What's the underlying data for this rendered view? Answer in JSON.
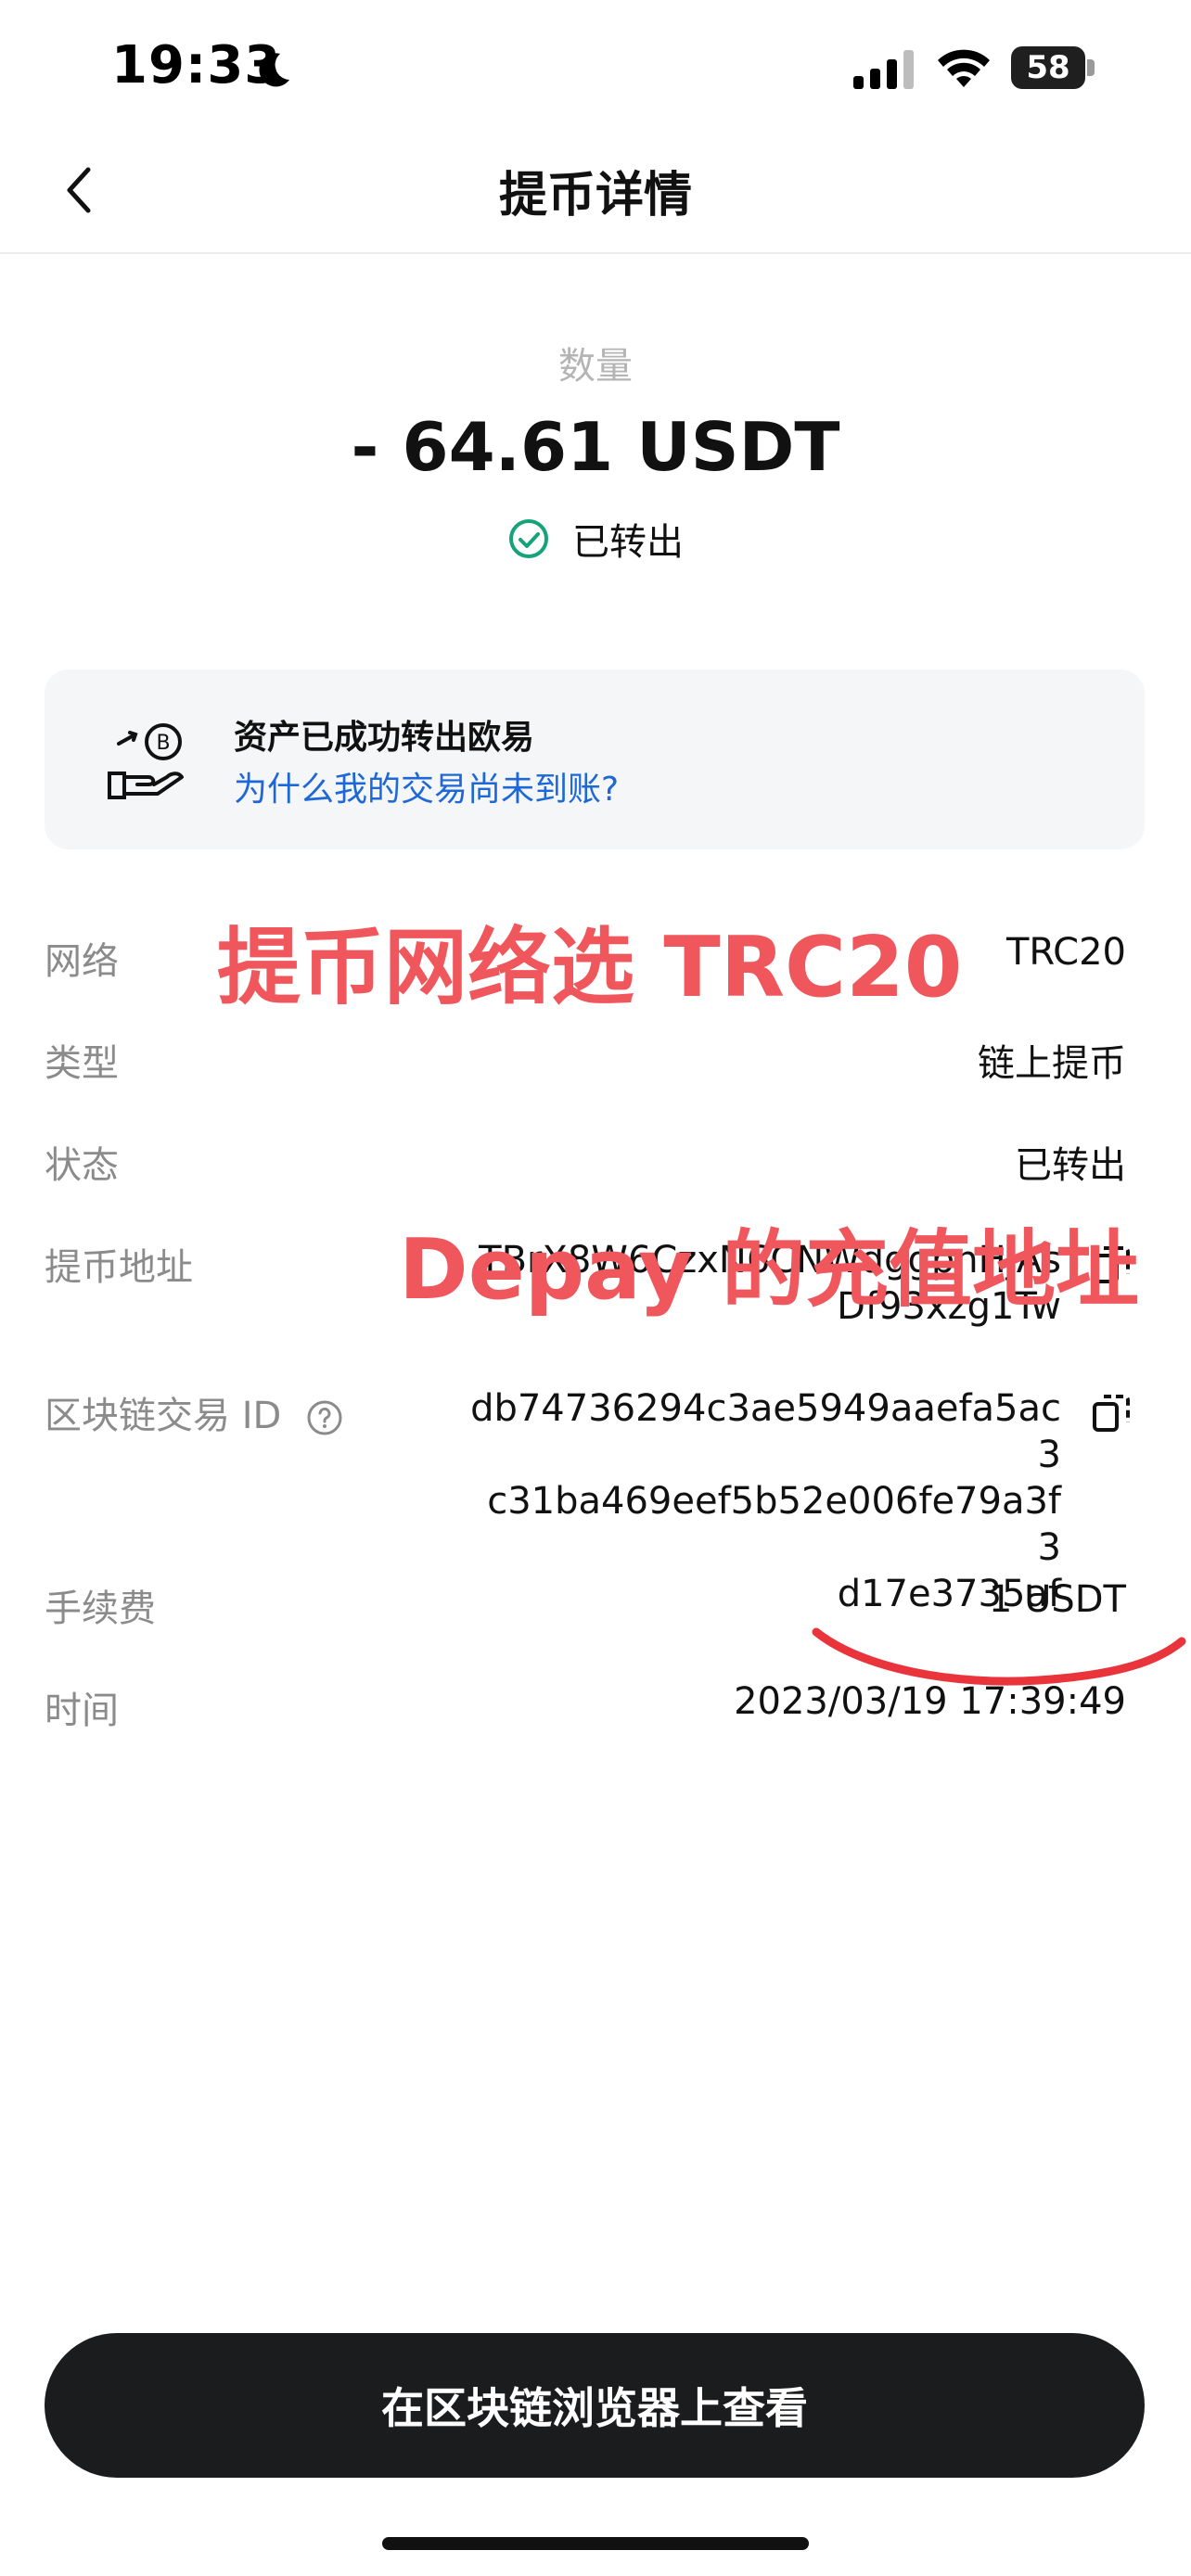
{
  "status_bar": {
    "time": "19:33",
    "battery": "58"
  },
  "header": {
    "title": "提币详情"
  },
  "amount": {
    "label": "数量",
    "value": "- 64.61 USDT",
    "status": "已转出"
  },
  "notice": {
    "title": "资产已成功转出欧易",
    "link": "为什么我的交易尚未到账?"
  },
  "details": {
    "network": {
      "label": "网络",
      "value": "TRC20"
    },
    "type": {
      "label": "类型",
      "value": "链上提币"
    },
    "state": {
      "label": "状态",
      "value": "已转出"
    },
    "address": {
      "label": "提币地址",
      "value_line1": "TBrX8W6CzxN6CNWdggpnHjAs",
      "value_line2": "Df93xzg1Tw"
    },
    "txid": {
      "label": "区块链交易 ID",
      "line1": "db74736294c3ae5949aaefa5ac3",
      "line2": "c31ba469eef5b52e006fe79a3f3",
      "line3": "d17e3735af"
    },
    "fee": {
      "label": "手续费",
      "value": "1 USDT"
    },
    "time": {
      "label": "时间",
      "value": "2023/03/19 17:39:49"
    }
  },
  "annotations": {
    "network_note": "提币网络选 TRC20",
    "address_note": "Depay 的充值地址",
    "color": "#f0575d"
  },
  "footer": {
    "button_label": "在区块链浏览器上查看"
  },
  "icons": [
    "moon-icon",
    "signal-icon",
    "wifi-icon",
    "back-icon",
    "check-circle-icon",
    "hand-coin-icon",
    "copy-icon",
    "help-icon"
  ]
}
